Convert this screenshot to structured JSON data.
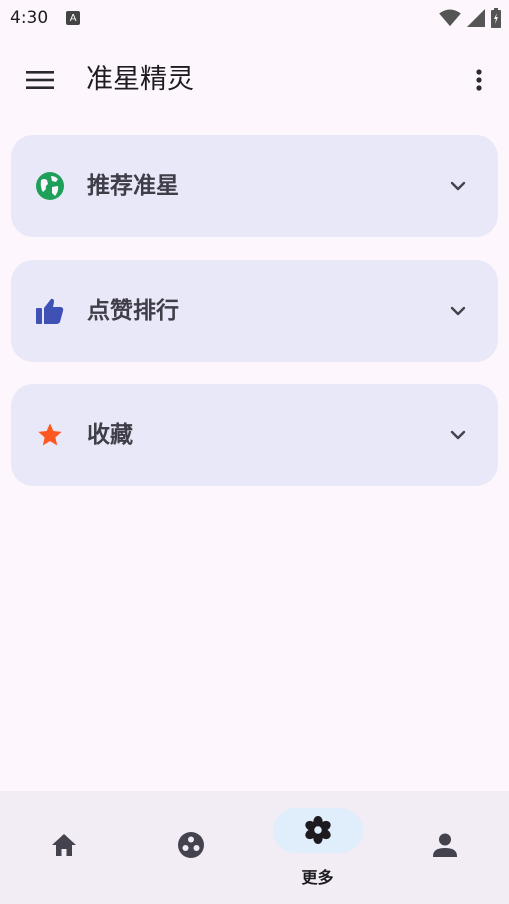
{
  "status_bar": {
    "time": "4:30",
    "notification_glyph": "A"
  },
  "app_bar": {
    "title": "准星精灵",
    "menu_icon": "hamburger-menu-icon",
    "more_icon": "more-vertical-icon"
  },
  "cards": [
    {
      "label": "推荐准星",
      "icon": "globe-icon",
      "icon_color": "#1fa05a"
    },
    {
      "label": "点赞排行",
      "icon": "thumbs-up-icon",
      "icon_color": "#3f51b5"
    },
    {
      "label": "收藏",
      "icon": "star-icon",
      "icon_color": "#ff5722"
    }
  ],
  "bottom_nav": {
    "items": [
      {
        "icon": "home-icon",
        "label": ""
      },
      {
        "icon": "games-icon",
        "label": ""
      },
      {
        "icon": "settings-flower-icon",
        "label": "更多",
        "active": true
      },
      {
        "icon": "person-icon",
        "label": ""
      }
    ]
  },
  "colors": {
    "background": "#fdf7fd",
    "card": "#e9e8f8",
    "nav_background": "#f2ecf4",
    "nav_active_pill": "#e0edfa"
  }
}
